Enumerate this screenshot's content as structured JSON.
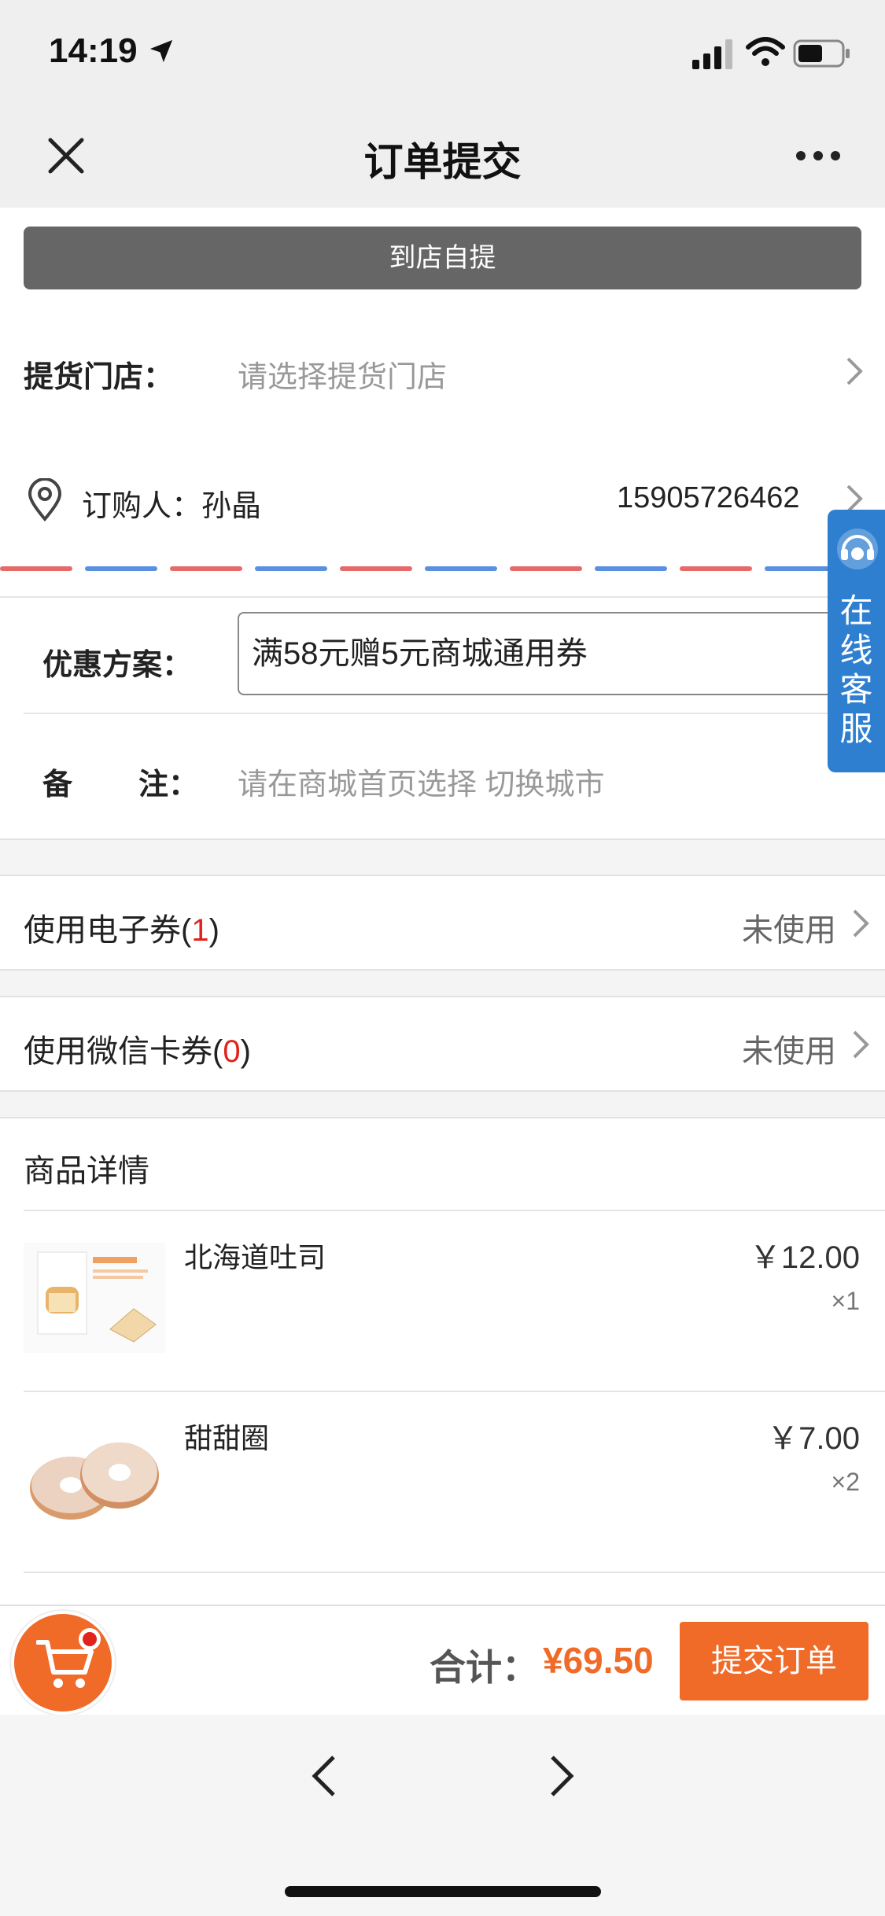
{
  "status_bar": {
    "time": "14:19",
    "icons": [
      "location-arrow-icon",
      "signal-icon",
      "wifi-icon",
      "battery-icon"
    ]
  },
  "nav": {
    "title": "订单提交",
    "close_icon": "close-icon",
    "more_icon": "more-icon"
  },
  "pickup_mode": "到店自提",
  "store": {
    "label": "提货门店：",
    "placeholder": "请选择提货门店"
  },
  "buyer": {
    "label": "订购人：孙晶",
    "phone": "15905726462"
  },
  "promotion": {
    "label": "优惠方案：",
    "value": "满58元赠5元商城通用券"
  },
  "remark": {
    "label_a": "备",
    "label_b": "注：",
    "placeholder": "请在商城首页选择 切换城市"
  },
  "customer_service": {
    "text": "在线客服",
    "color": "#2f7fd0"
  },
  "coupons": [
    {
      "label": "使用电子券(",
      "count": "1",
      "suffix": ")",
      "status": "未使用"
    },
    {
      "label": "使用微信卡券(",
      "count": "0",
      "suffix": ")",
      "status": "未使用"
    }
  ],
  "products_section_title": "商品详情",
  "products": [
    {
      "name": "北海道吐司",
      "price": "￥12.00",
      "qty": "×1",
      "image": "toast-image"
    },
    {
      "name": "甜甜圈",
      "price": "￥7.00",
      "qty": "×2",
      "image": "donut-image"
    }
  ],
  "footer": {
    "total_label": "合计：",
    "total_value": "¥69.50",
    "submit_label": "提交订单",
    "accent": "#f06a28"
  }
}
